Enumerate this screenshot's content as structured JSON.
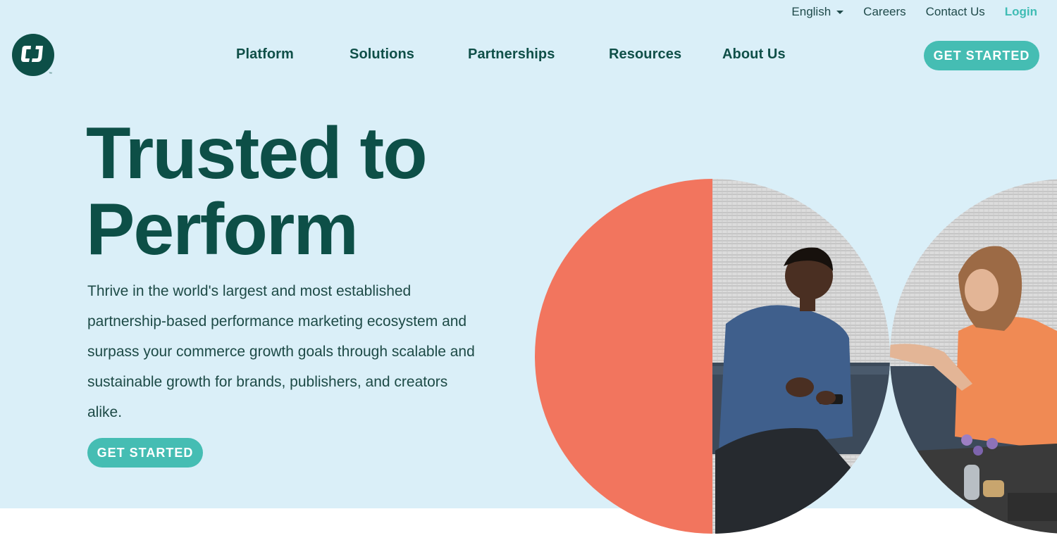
{
  "utility_nav": {
    "language": "English",
    "careers": "Careers",
    "contact": "Contact Us",
    "login": "Login"
  },
  "logo": {
    "text": "CJ",
    "trademark": "™"
  },
  "main_nav": {
    "items": [
      {
        "label": "Platform"
      },
      {
        "label": "Solutions"
      },
      {
        "label": "Partnerships"
      },
      {
        "label": "Resources"
      },
      {
        "label": "About Us"
      }
    ]
  },
  "header_cta": "GET STARTED",
  "hero": {
    "headline_line1": "Trusted to",
    "headline_line2": "Perform",
    "description": "Thrive in the world's largest and most established partnership-based performance marketing ecosystem and surpass your commerce growth goals through scalable and sustainable growth for brands, publishers, and creators alike.",
    "cta": "GET STARTED"
  },
  "colors": {
    "hero_bg": "#daeff8",
    "brand_dark": "#0d4f47",
    "accent_teal": "#45bdb3",
    "coral": "#f2755e"
  }
}
